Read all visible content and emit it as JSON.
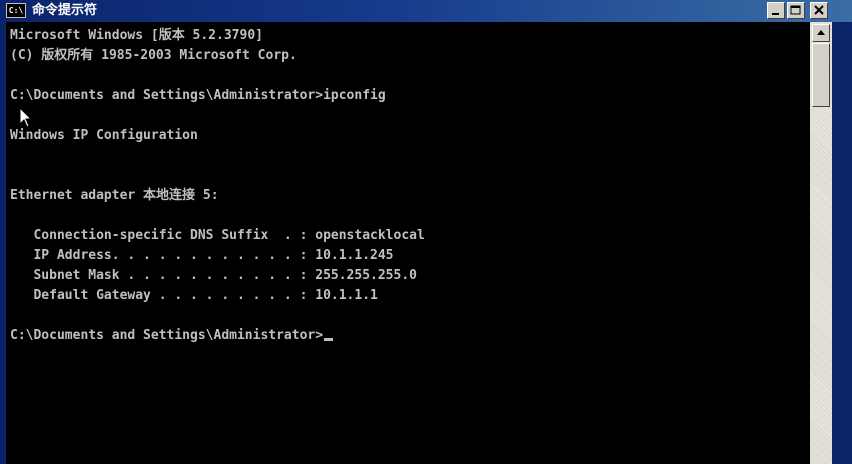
{
  "window": {
    "title": "命令提示符",
    "icon": "cmd-icon",
    "icon_text": "C:\\"
  },
  "controls": {
    "minimize": "minimize-icon",
    "maximize": "maximize-icon",
    "close": "close-icon"
  },
  "console": {
    "lines": [
      "Microsoft Windows [版本 5.2.3790]",
      "(C) 版权所有 1985-2003 Microsoft Corp.",
      "",
      "C:\\Documents and Settings\\Administrator>ipconfig",
      "",
      "Windows IP Configuration",
      "",
      "",
      "Ethernet adapter 本地连接 5:",
      "",
      "   Connection-specific DNS Suffix  . : openstacklocal",
      "   IP Address. . . . . . . . . . . . : 10.1.1.245",
      "   Subnet Mask . . . . . . . . . . . : 255.255.255.0",
      "   Default Gateway . . . . . . . . . : 10.1.1.1",
      "",
      "C:\\Documents and Settings\\Administrator>"
    ]
  },
  "colors": {
    "console_bg": "#000000",
    "console_fg": "#c0c0c0",
    "titlebar": "#0a246a"
  }
}
